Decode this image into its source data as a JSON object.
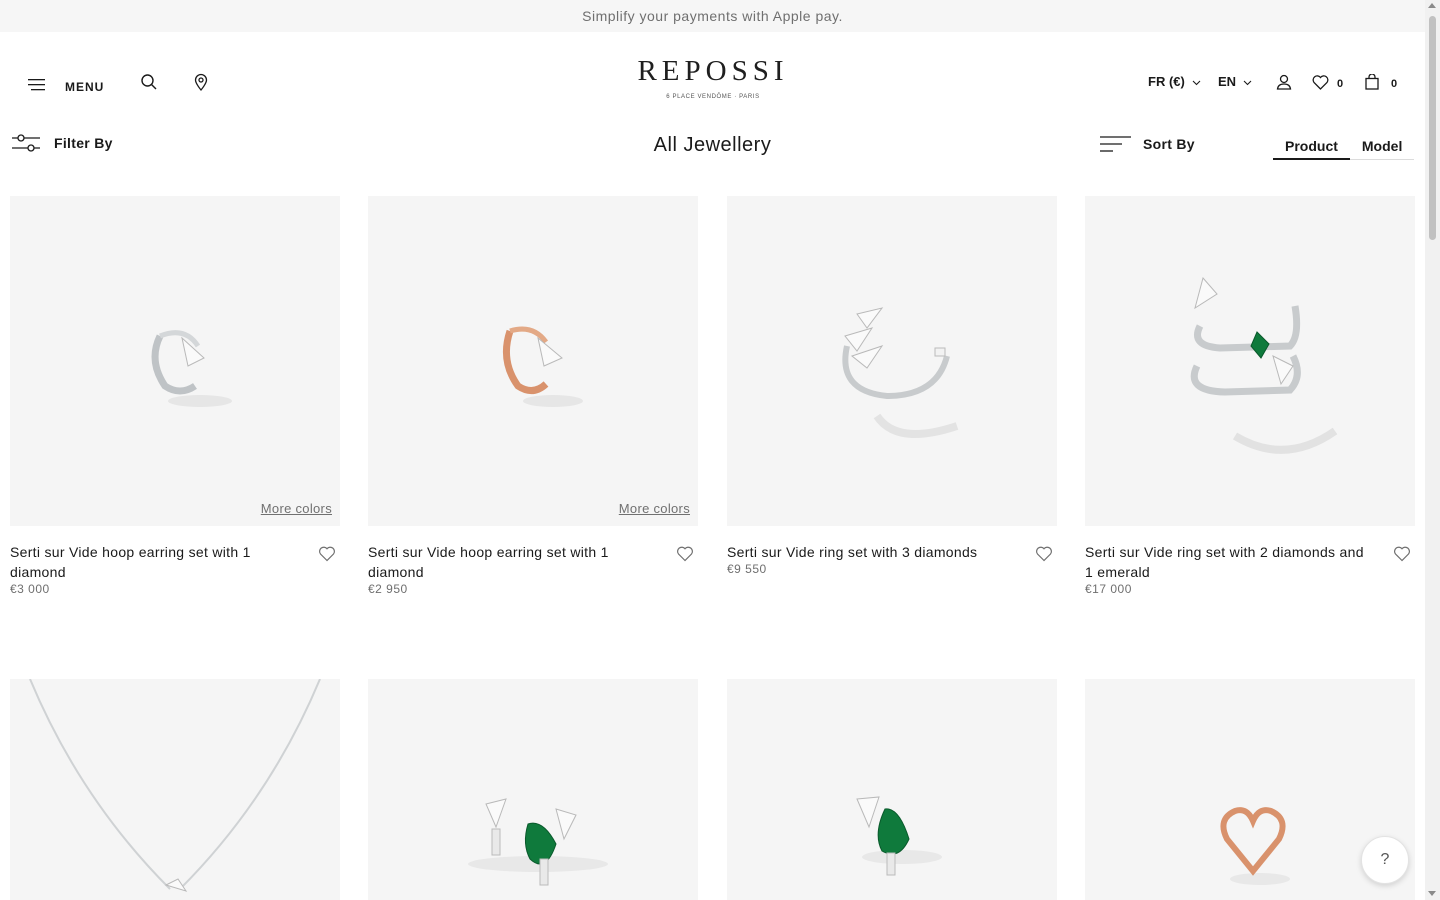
{
  "promo": {
    "text": "Simplify your payments with Apple pay."
  },
  "header": {
    "menu_label": "MENU",
    "logo_text": "REPOSSI",
    "logo_sub": "6 PLACE VENDÔME · PARIS",
    "currency": "FR (€)",
    "language": "EN",
    "wishlist_count": "0",
    "cart_count": "0"
  },
  "toolbar": {
    "filter_label": "Filter By",
    "title": "All Jewellery",
    "sort_label": "Sort By",
    "view_product": "Product",
    "view_model": "Model"
  },
  "products": [
    {
      "name": "Serti sur Vide hoop earring set with 1 diamond",
      "price": "€3 000",
      "more": "More colors"
    },
    {
      "name": "Serti sur Vide hoop earring set with 1 diamond",
      "price": "€2 950",
      "more": "More colors"
    },
    {
      "name": "Serti sur Vide ring set with 3 diamonds",
      "price": "€9 550",
      "more": ""
    },
    {
      "name": "Serti sur Vide ring set with 2 diamonds and 1 emerald",
      "price": "€17 000",
      "more": ""
    }
  ],
  "help_label": "?",
  "colors": {
    "promo_bg": "#f6f6f6",
    "card_bg": "#f5f5f5",
    "text": "#1a1a1a",
    "muted": "#6f6f6f",
    "emerald": "#0f7a3c",
    "rose_gold": "#d9926c"
  }
}
